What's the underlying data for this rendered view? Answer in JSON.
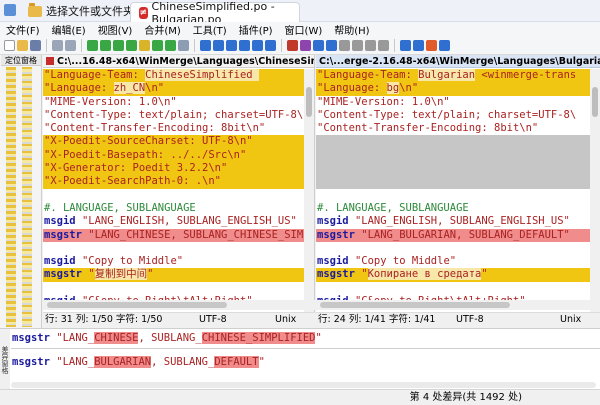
{
  "tabs": [
    {
      "label": "选择文件或文件夹"
    },
    {
      "label": "ChineseSimplified.po - Bulgarian.po"
    }
  ],
  "menu": [
    "文件(F)",
    "编辑(E)",
    "视图(V)",
    "合并(M)",
    "工具(T)",
    "插件(P)",
    "窗口(W)",
    "帮助(H)"
  ],
  "location_pane": {
    "label": "定位窗格"
  },
  "left_pane": {
    "path": "C:\\...16.48-x64\\WinMerge\\Languages\\ChineseSimplified.po",
    "status": {
      "pos": "行: 31  列: 1/50  字符: 1/50",
      "encoding": "UTF-8",
      "eol": "Unix"
    }
  },
  "right_pane": {
    "path": "C:\\...erge-2.16.48-x64\\WinMerge\\Languages\\Bulgarian.po",
    "status": {
      "pos": "行: 24  列: 1/41  字符: 1/41",
      "encoding": "UTF-8",
      "eol": "Unix"
    }
  },
  "detail": {
    "side_label": "差异窗格",
    "left": {
      "a": "msgstr \"LANG_",
      "b": "CHINESE",
      "c": ", SUBLANG_",
      "d": "CHINESE_SIMPLIFIED",
      "e": "\""
    },
    "right": {
      "a": "msgstr \"LANG_",
      "b": "BULGARIAN",
      "c": ", SUBLANG_",
      "d": "DEFAULT",
      "e": "\""
    }
  },
  "statusbar": {
    "text": "第 4 处差异(共 1492 处)"
  },
  "colors": {
    "diff": "#f0c613",
    "selected_diff": "#f08c8c",
    "missing": "#c6c6c6"
  }
}
